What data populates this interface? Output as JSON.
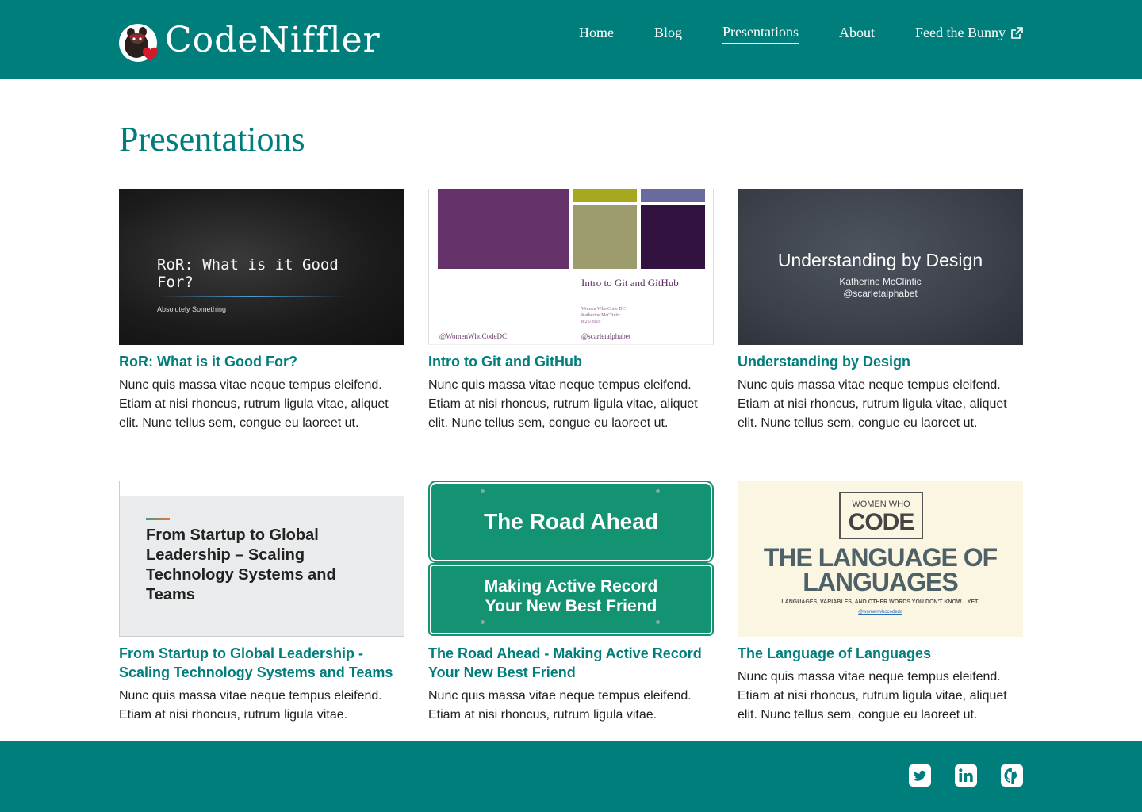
{
  "header": {
    "logo_text": "CodeNiffler",
    "nav": [
      {
        "label": "Home"
      },
      {
        "label": "Blog"
      },
      {
        "label": "Presentations",
        "active": true
      },
      {
        "label": "About"
      },
      {
        "label": "Feed the Bunny",
        "external": true
      }
    ]
  },
  "colors": {
    "brand_teal": "#007e7c",
    "white": "#ffffff",
    "text": "#222222"
  },
  "main": {
    "title": "Presentations",
    "cards": [
      {
        "title": "RoR: What is it Good For?",
        "description": "Nunc quis massa vitae neque tempus eleifend. Etiam at nisi rhoncus, rutrum ligula vitae, aliquet elit. Nunc tellus sem, congue eu laoreet ut.",
        "thumb": {
          "title": "RoR: What is it Good\nFor?",
          "subtitle": "Absolutely Something"
        }
      },
      {
        "title": "Intro to Git and GitHub",
        "description": "Nunc quis massa vitae neque tempus eleifend. Etiam at nisi rhoncus, rutrum ligula vitae, aliquet elit. Nunc tellus sem, congue eu laoreet ut.",
        "thumb": {
          "title": "Intro to Git and GitHub",
          "meta": "Women Who Code DC\nKatherine McClintic\n8/25/2016",
          "handle_left": "@WomenWhoCodeDC",
          "handle_right": "@scarletalphabet"
        }
      },
      {
        "title": "Understanding by Design",
        "description": "Nunc quis massa vitae neque tempus eleifend. Etiam at nisi rhoncus, rutrum ligula vitae, aliquet elit. Nunc tellus sem, congue eu laoreet ut.",
        "thumb": {
          "title": "Understanding by Design",
          "subtitle": "Katherine McClintic\n@scarletalphabet"
        }
      },
      {
        "title": "From Startup to Global Leadership - Scaling Technology Systems and Teams",
        "description": "Nunc quis massa vitae neque tempus eleifend. Etiam at nisi rhoncus, rutrum ligula vitae.",
        "thumb": {
          "title": "From Startup to Global Leadership – Scaling Technology Systems and Teams"
        }
      },
      {
        "title": "The Road Ahead - Making Active Record Your New Best Friend",
        "description": "Nunc quis massa vitae neque tempus eleifend. Etiam at nisi rhoncus, rutrum ligula vitae.",
        "thumb": {
          "title": "The Road Ahead",
          "subtitle": "Making Active Record\nYour New Best Friend"
        }
      },
      {
        "title": "The Language of Languages",
        "description": "Nunc quis massa vitae neque tempus eleifend. Etiam at nisi rhoncus, rutrum ligula vitae, aliquet elit. Nunc tellus sem, congue eu laoreet ut.",
        "thumb": {
          "brand_line1": "WOMEN WHO",
          "brand_line2": "CODE",
          "title": "THE LANGUAGE OF\nLANGUAGES",
          "tagline": "LANGUAGES, VARIABLES, AND OTHER WORDS YOU DON'T KNOW... YET.",
          "url": "@womenwhocodedc"
        }
      }
    ]
  },
  "footer": {
    "social": [
      {
        "icon": "twitter-icon"
      },
      {
        "icon": "linkedin-icon"
      },
      {
        "icon": "github-icon"
      }
    ]
  }
}
